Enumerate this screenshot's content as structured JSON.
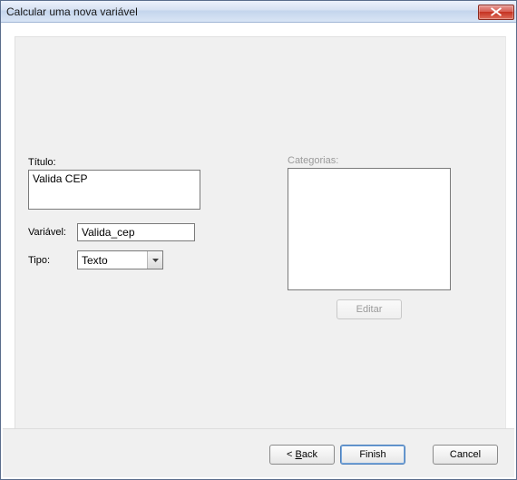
{
  "window": {
    "title": "Calcular uma nova variável",
    "close_icon": "close"
  },
  "form": {
    "titulo_label": "Título:",
    "titulo_value": "Valida CEP",
    "variavel_label": "Variável:",
    "variavel_value": "Valida_cep",
    "tipo_label": "Tipo:",
    "tipo_value": "Texto"
  },
  "categories": {
    "label": "Categorias:",
    "edit_button": "Editar"
  },
  "footer": {
    "back_prefix": "< ",
    "back_mnemonic": "B",
    "back_suffix": "ack",
    "finish": "Finish",
    "cancel": "Cancel"
  }
}
